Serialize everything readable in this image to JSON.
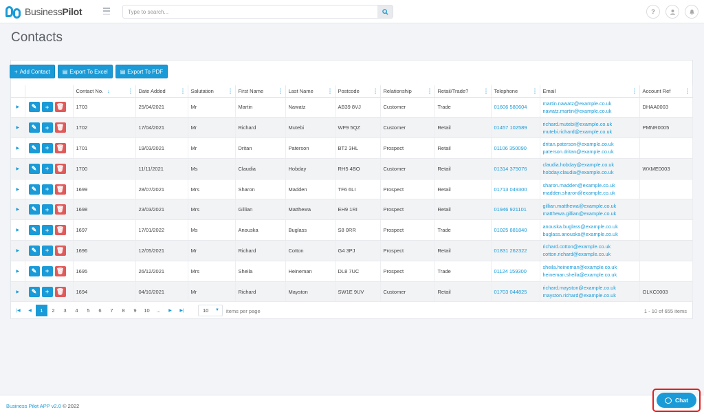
{
  "app": {
    "logo_text_light": "Business",
    "logo_text_bold": "Pilot",
    "search_placeholder": "Type to search...",
    "help_icon_glyph": "?"
  },
  "page": {
    "title": "Contacts"
  },
  "toolbar": {
    "add_label": "Add Contact",
    "excel_label": "Export To Excel",
    "pdf_label": "Export To PDF"
  },
  "table": {
    "columns": [
      "Contact No.",
      "Date Added",
      "Salutation",
      "First Name",
      "Last Name",
      "Postcode",
      "Relationship",
      "Retail/Trade?",
      "Telephone",
      "Email",
      "Account Ref"
    ],
    "rows": [
      {
        "no": "1703",
        "date": "25/04/2021",
        "sal": "Mr",
        "first": "Martin",
        "last": "Nawatz",
        "postcode": "AB39 8VJ",
        "rel": "Customer",
        "rt": "Trade",
        "tel": "01606 580604",
        "email1": "martin.nawatz@example.co.uk",
        "email2": "nawatz.martin@example.co.uk",
        "ref": "DHAA0003"
      },
      {
        "no": "1702",
        "date": "17/04/2021",
        "sal": "Mr",
        "first": "Richard",
        "last": "Mutebi",
        "postcode": "WF9 5QZ",
        "rel": "Customer",
        "rt": "Retail",
        "tel": "01457 102589",
        "email1": "richard.mutebi@example.co.uk",
        "email2": "mutebi.richard@example.co.uk",
        "ref": "PMNR0005"
      },
      {
        "no": "1701",
        "date": "19/03/2021",
        "sal": "Mr",
        "first": "Dritan",
        "last": "Paterson",
        "postcode": "BT2 3HL",
        "rel": "Prospect",
        "rt": "Retail",
        "tel": "01106 350090",
        "email1": "dritan.paterson@example.co.uk",
        "email2": "paterson.dritan@example.co.uk",
        "ref": ""
      },
      {
        "no": "1700",
        "date": "11/11/2021",
        "sal": "Ms",
        "first": "Claudia",
        "last": "Hobday",
        "postcode": "RH5 4BO",
        "rel": "Customer",
        "rt": "Retail",
        "tel": "01314 375076",
        "email1": "claudia.hobday@example.co.uk",
        "email2": "hobday.claudia@example.co.uk",
        "ref": "WXME0003"
      },
      {
        "no": "1699",
        "date": "28/07/2021",
        "sal": "Mrs",
        "first": "Sharon",
        "last": "Madden",
        "postcode": "TF6 6LI",
        "rel": "Prospect",
        "rt": "Retail",
        "tel": "01713 049300",
        "email1": "sharon.madden@example.co.uk",
        "email2": "madden.sharon@example.co.uk",
        "ref": ""
      },
      {
        "no": "1698",
        "date": "23/03/2021",
        "sal": "Mrs",
        "first": "Gillian",
        "last": "Matthewa",
        "postcode": "EH9 1RI",
        "rel": "Prospect",
        "rt": "Retail",
        "tel": "01946 921101",
        "email1": "gillian.matthewa@example.co.uk",
        "email2": "matthewa.gillian@example.co.uk",
        "ref": ""
      },
      {
        "no": "1697",
        "date": "17/01/2022",
        "sal": "Ms",
        "first": "Anouska",
        "last": "Buglass",
        "postcode": "S8 0RR",
        "rel": "Prospect",
        "rt": "Trade",
        "tel": "01025 881840",
        "email1": "anouska.buglass@example.co.uk",
        "email2": "buglass.anouska@example.co.uk",
        "ref": ""
      },
      {
        "no": "1696",
        "date": "12/05/2021",
        "sal": "Mr",
        "first": "Richard",
        "last": "Cotton",
        "postcode": "G4 3PJ",
        "rel": "Prospect",
        "rt": "Retail",
        "tel": "01831 262322",
        "email1": "richard.cotton@example.co.uk",
        "email2": "cotton.richard@example.co.uk",
        "ref": ""
      },
      {
        "no": "1695",
        "date": "26/12/2021",
        "sal": "Mrs",
        "first": "Sheila",
        "last": "Heineman",
        "postcode": "DL8 7UC",
        "rel": "Prospect",
        "rt": "Trade",
        "tel": "01124 159300",
        "email1": "sheila.heineman@example.co.uk",
        "email2": "heineman.sheila@example.co.uk",
        "ref": ""
      },
      {
        "no": "1694",
        "date": "04/10/2021",
        "sal": "Mr",
        "first": "Richard",
        "last": "Mayston",
        "postcode": "SW1E 9UV",
        "rel": "Customer",
        "rt": "Retail",
        "tel": "01703 044825",
        "email1": "richard.mayston@example.co.uk",
        "email2": "mayston.richard@example.co.uk",
        "ref": "OLKC0003"
      }
    ]
  },
  "pager": {
    "pages": [
      "1",
      "2",
      "3",
      "4",
      "5",
      "6",
      "7",
      "8",
      "9",
      "10",
      "..."
    ],
    "active_page": "1",
    "per_page": "10",
    "per_page_label": "items per page",
    "info": "1 - 10 of 655 items"
  },
  "footer": {
    "brand": "Business Pilot APP v2.0",
    "copyright": "© 2022"
  },
  "chat": {
    "label": "Chat"
  },
  "colors": {
    "accent": "#1a9bd7",
    "danger": "#e05a5a",
    "highlight": "#e02020"
  }
}
